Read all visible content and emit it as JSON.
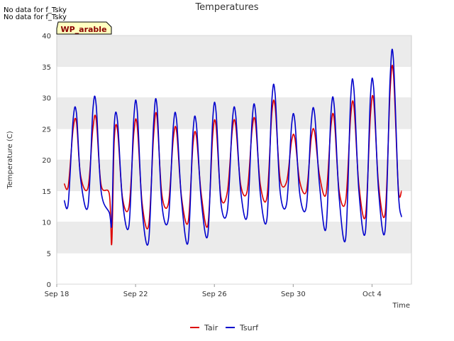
{
  "notes": [
    "No data for f_Tsky",
    "No data for f_Tsky"
  ],
  "badge": "WP_arable",
  "colors": {
    "Tair": "#dd0000",
    "Tsurf": "#0000cc",
    "band": "#ebebeb",
    "axis": "#cccccc",
    "badge_bg": "#ffffc0",
    "badge_text": "#8b0000"
  },
  "chart_data": {
    "type": "line",
    "title": "Temperatures",
    "xlabel": "Time",
    "ylabel": "Temperature (C)",
    "ylim": [
      0,
      40
    ],
    "yticks": [
      0,
      5,
      10,
      15,
      20,
      25,
      30,
      35,
      40
    ],
    "xlim": [
      "2023-09-18",
      "2023-10-06"
    ],
    "xticks": [
      {
        "date": "2023-09-18",
        "label": "Sep 18"
      },
      {
        "date": "2023-09-22",
        "label": "Sep 22"
      },
      {
        "date": "2023-09-26",
        "label": "Sep 26"
      },
      {
        "date": "2023-09-30",
        "label": "Sep 30"
      },
      {
        "date": "2023-10-04",
        "label": "Oct 4"
      }
    ],
    "grid": "horizontal bands",
    "legend_position": "bottom",
    "series": [
      {
        "name": "Tair",
        "color": "#dd0000",
        "points": [
          [
            "2023-09-18 09:00",
            16.2
          ],
          [
            "2023-09-18 14:00",
            15.8
          ],
          [
            "2023-09-18 20:00",
            25.0
          ],
          [
            "2023-09-19 00:00",
            26.0
          ],
          [
            "2023-09-19 05:00",
            17.5
          ],
          [
            "2023-09-19 14:00",
            15.5
          ],
          [
            "2023-09-19 20:00",
            25.0
          ],
          [
            "2023-09-20 00:00",
            26.5
          ],
          [
            "2023-09-20 06:00",
            16.0
          ],
          [
            "2023-09-20 16:00",
            14.5
          ],
          [
            "2023-09-20 19:00",
            6.5
          ],
          [
            "2023-09-20 22:00",
            23.0
          ],
          [
            "2023-09-21 02:00",
            24.8
          ],
          [
            "2023-09-21 08:00",
            14.0
          ],
          [
            "2023-09-21 16:00",
            12.5
          ],
          [
            "2023-09-21 22:00",
            24.5
          ],
          [
            "2023-09-22 02:00",
            25.5
          ],
          [
            "2023-09-22 08:00",
            13.0
          ],
          [
            "2023-09-22 16:00",
            9.5
          ],
          [
            "2023-09-22 22:00",
            24.0
          ],
          [
            "2023-09-23 02:00",
            27.0
          ],
          [
            "2023-09-23 08:00",
            14.5
          ],
          [
            "2023-09-23 16:00",
            13.0
          ],
          [
            "2023-09-23 22:00",
            23.5
          ],
          [
            "2023-09-24 02:00",
            24.5
          ],
          [
            "2023-09-24 08:00",
            14.0
          ],
          [
            "2023-09-24 16:00",
            10.0
          ],
          [
            "2023-09-24 22:00",
            22.5
          ],
          [
            "2023-09-25 02:00",
            23.8
          ],
          [
            "2023-09-25 08:00",
            14.5
          ],
          [
            "2023-09-25 16:00",
            9.5
          ],
          [
            "2023-09-25 22:00",
            24.0
          ],
          [
            "2023-09-26 02:00",
            25.5
          ],
          [
            "2023-09-26 08:00",
            14.0
          ],
          [
            "2023-09-26 16:00",
            15.0
          ],
          [
            "2023-09-26 22:00",
            25.0
          ],
          [
            "2023-09-27 02:00",
            25.5
          ],
          [
            "2023-09-27 08:00",
            16.0
          ],
          [
            "2023-09-27 16:00",
            15.0
          ],
          [
            "2023-09-27 22:00",
            25.0
          ],
          [
            "2023-09-28 02:00",
            26.0
          ],
          [
            "2023-09-28 08:00",
            16.0
          ],
          [
            "2023-09-28 16:00",
            14.0
          ],
          [
            "2023-09-28 22:00",
            27.5
          ],
          [
            "2023-09-29 02:00",
            28.5
          ],
          [
            "2023-09-29 08:00",
            17.0
          ],
          [
            "2023-09-29 16:00",
            16.5
          ],
          [
            "2023-09-29 22:00",
            23.0
          ],
          [
            "2023-09-30 02:00",
            23.5
          ],
          [
            "2023-09-30 08:00",
            16.5
          ],
          [
            "2023-09-30 16:00",
            15.0
          ],
          [
            "2023-09-30 22:00",
            23.5
          ],
          [
            "2023-10-01 02:00",
            24.5
          ],
          [
            "2023-10-01 08:00",
            17.5
          ],
          [
            "2023-10-01 16:00",
            14.5
          ],
          [
            "2023-10-01 22:00",
            25.5
          ],
          [
            "2023-10-02 02:00",
            26.5
          ],
          [
            "2023-10-02 08:00",
            15.0
          ],
          [
            "2023-10-02 16:00",
            13.5
          ],
          [
            "2023-10-02 22:00",
            27.0
          ],
          [
            "2023-10-03 02:00",
            28.5
          ],
          [
            "2023-10-03 08:00",
            16.0
          ],
          [
            "2023-10-03 16:00",
            11.0
          ],
          [
            "2023-10-03 22:00",
            27.0
          ],
          [
            "2023-10-04 02:00",
            29.5
          ],
          [
            "2023-10-04 08:00",
            16.0
          ],
          [
            "2023-10-04 16:00",
            11.5
          ],
          [
            "2023-10-04 22:00",
            31.0
          ],
          [
            "2023-10-05 02:00",
            34.0
          ],
          [
            "2023-10-05 08:00",
            15.5
          ],
          [
            "2023-10-05 12:00",
            15.0
          ]
        ]
      },
      {
        "name": "Tsurf",
        "color": "#0000cc",
        "points": [
          [
            "2023-09-18 09:00",
            13.5
          ],
          [
            "2023-09-18 14:00",
            13.0
          ],
          [
            "2023-09-18 20:00",
            26.5
          ],
          [
            "2023-09-19 00:00",
            27.5
          ],
          [
            "2023-09-19 05:00",
            17.0
          ],
          [
            "2023-09-19 14:00",
            12.5
          ],
          [
            "2023-09-19 20:00",
            28.0
          ],
          [
            "2023-09-20 00:00",
            28.8
          ],
          [
            "2023-09-20 06:00",
            15.0
          ],
          [
            "2023-09-20 16:00",
            11.5
          ],
          [
            "2023-09-20 19:00",
            10.0
          ],
          [
            "2023-09-20 22:00",
            25.5
          ],
          [
            "2023-09-21 02:00",
            26.3
          ],
          [
            "2023-09-21 08:00",
            13.5
          ],
          [
            "2023-09-21 16:00",
            9.5
          ],
          [
            "2023-09-21 22:00",
            27.0
          ],
          [
            "2023-09-22 02:00",
            28.0
          ],
          [
            "2023-09-22 08:00",
            12.0
          ],
          [
            "2023-09-22 16:00",
            7.0
          ],
          [
            "2023-09-22 22:00",
            26.0
          ],
          [
            "2023-09-23 02:00",
            28.8
          ],
          [
            "2023-09-23 08:00",
            13.0
          ],
          [
            "2023-09-23 16:00",
            10.5
          ],
          [
            "2023-09-23 22:00",
            25.5
          ],
          [
            "2023-09-24 02:00",
            26.3
          ],
          [
            "2023-09-24 08:00",
            13.5
          ],
          [
            "2023-09-24 16:00",
            6.8
          ],
          [
            "2023-09-24 22:00",
            24.5
          ],
          [
            "2023-09-25 02:00",
            25.8
          ],
          [
            "2023-09-25 08:00",
            13.5
          ],
          [
            "2023-09-25 16:00",
            8.0
          ],
          [
            "2023-09-25 22:00",
            26.5
          ],
          [
            "2023-09-26 02:00",
            27.8
          ],
          [
            "2023-09-26 08:00",
            13.0
          ],
          [
            "2023-09-26 16:00",
            12.0
          ],
          [
            "2023-09-26 22:00",
            26.5
          ],
          [
            "2023-09-27 02:00",
            27.2
          ],
          [
            "2023-09-27 08:00",
            15.0
          ],
          [
            "2023-09-27 16:00",
            11.0
          ],
          [
            "2023-09-27 22:00",
            26.5
          ],
          [
            "2023-09-28 02:00",
            27.8
          ],
          [
            "2023-09-28 08:00",
            14.5
          ],
          [
            "2023-09-28 16:00",
            10.5
          ],
          [
            "2023-09-28 22:00",
            29.5
          ],
          [
            "2023-09-29 02:00",
            30.5
          ],
          [
            "2023-09-29 08:00",
            15.0
          ],
          [
            "2023-09-29 16:00",
            13.0
          ],
          [
            "2023-09-29 22:00",
            25.5
          ],
          [
            "2023-09-30 02:00",
            26.3
          ],
          [
            "2023-09-30 08:00",
            14.5
          ],
          [
            "2023-09-30 16:00",
            12.5
          ],
          [
            "2023-09-30 22:00",
            26.0
          ],
          [
            "2023-10-01 02:00",
            27.5
          ],
          [
            "2023-10-01 08:00",
            16.0
          ],
          [
            "2023-10-01 16:00",
            9.0
          ],
          [
            "2023-10-01 22:00",
            27.5
          ],
          [
            "2023-10-02 02:00",
            28.6
          ],
          [
            "2023-10-02 08:00",
            14.0
          ],
          [
            "2023-10-02 16:00",
            7.5
          ],
          [
            "2023-10-02 22:00",
            30.0
          ],
          [
            "2023-10-03 02:00",
            31.2
          ],
          [
            "2023-10-03 08:00",
            15.0
          ],
          [
            "2023-10-03 16:00",
            8.5
          ],
          [
            "2023-10-03 22:00",
            30.0
          ],
          [
            "2023-10-04 02:00",
            31.5
          ],
          [
            "2023-10-04 08:00",
            15.0
          ],
          [
            "2023-10-04 16:00",
            8.8
          ],
          [
            "2023-10-04 22:00",
            33.0
          ],
          [
            "2023-10-05 02:00",
            36.3
          ],
          [
            "2023-10-05 08:00",
            15.0
          ],
          [
            "2023-10-05 12:00",
            10.8
          ]
        ]
      }
    ]
  }
}
